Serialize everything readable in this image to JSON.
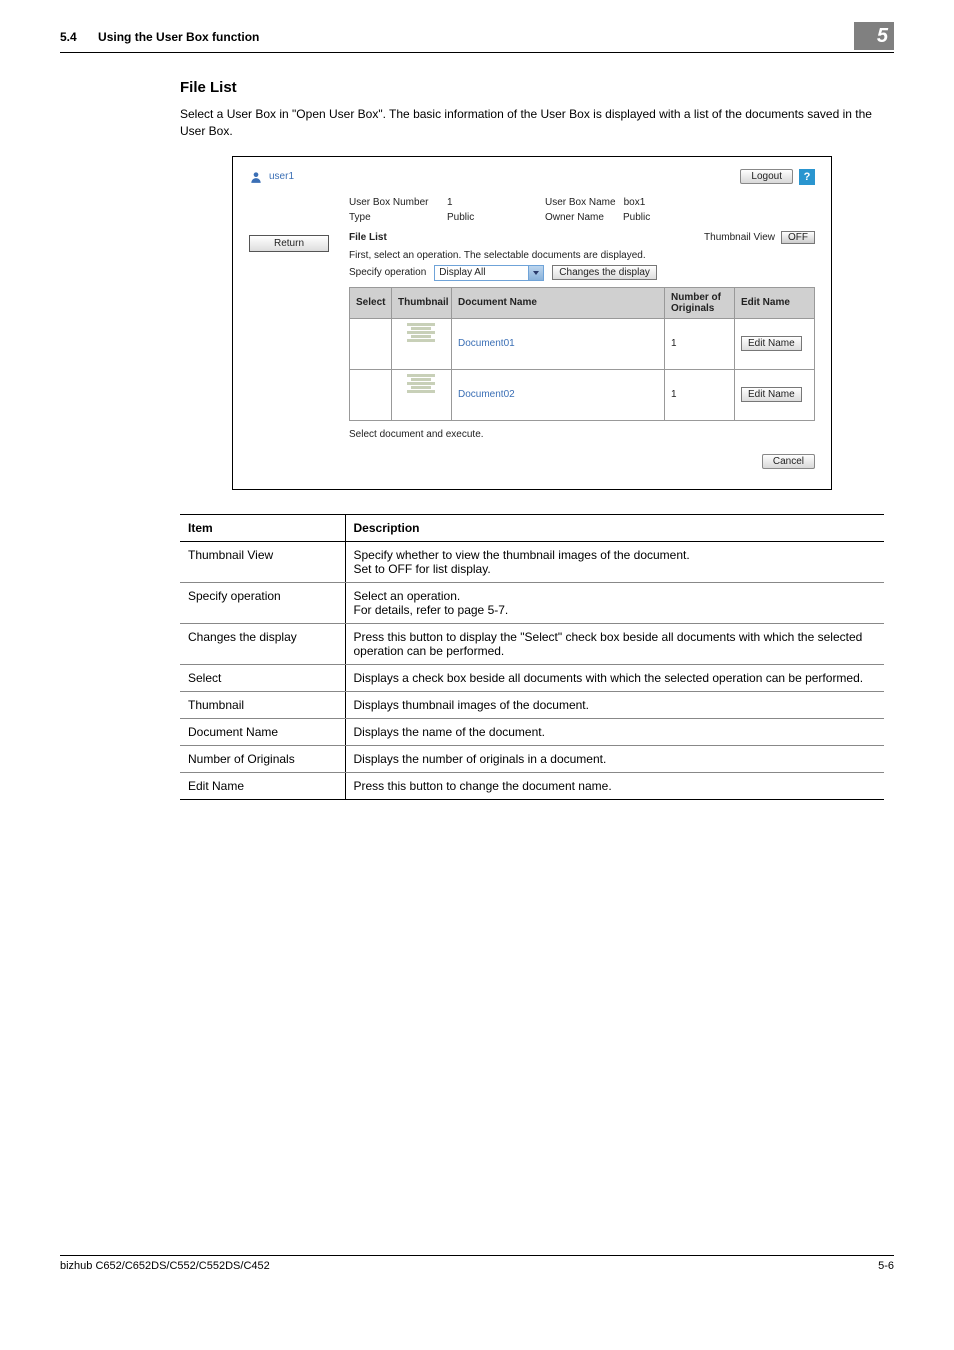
{
  "header": {
    "section_num": "5.4",
    "section_title": "Using the User Box function",
    "chapter_badge": "5"
  },
  "body": {
    "h2": "File List",
    "intro": "Select a User Box in \"Open User Box\". The basic information of the User Box is displayed with a list of the documents saved in the User Box."
  },
  "shot": {
    "username": "user1",
    "logout": "Logout",
    "help": "?",
    "return": "Return",
    "kv": {
      "boxnum_label": "User Box Number",
      "boxnum_value": "1",
      "boxname_label": "User Box Name",
      "boxname_value": "box1",
      "type_label": "Type",
      "type_value": "Public",
      "owner_label": "Owner Name",
      "owner_value": "Public"
    },
    "file_list_label": "File List",
    "thumb_view_label": "Thumbnail View",
    "thumb_view_btn": "OFF",
    "first_select": "First, select an operation. The selectable documents are displayed.",
    "specify_op_label": "Specify operation",
    "specify_op_value": "Display All",
    "changes_btn": "Changes the display",
    "cols": {
      "select": "Select",
      "thumb": "Thumbnail",
      "docname": "Document Name",
      "numorig": "Number of Originals",
      "editname": "Edit Name"
    },
    "rows": [
      {
        "name": "Document01",
        "num": "1",
        "edit": "Edit Name"
      },
      {
        "name": "Document02",
        "num": "1",
        "edit": "Edit Name"
      }
    ],
    "below": "Select document and execute.",
    "cancel": "Cancel"
  },
  "table": {
    "head_item": "Item",
    "head_desc": "Description",
    "rows": [
      {
        "item": "Thumbnail View",
        "desc": "Specify whether to view the thumbnail images of the document.\nSet to OFF for list display."
      },
      {
        "item": "Specify operation",
        "desc": "Select an operation.\nFor details, refer to page 5-7."
      },
      {
        "item": "Changes the display",
        "desc": "Press this button to display the \"Select\" check box beside all documents with which the selected operation can be performed."
      },
      {
        "item": "Select",
        "desc": "Displays a check box beside all documents with which the selected operation can be performed."
      },
      {
        "item": "Thumbnail",
        "desc": "Displays thumbnail images of the document."
      },
      {
        "item": "Document Name",
        "desc": "Displays the name of the document."
      },
      {
        "item": "Number of Originals",
        "desc": "Displays the number of originals in a document."
      },
      {
        "item": "Edit Name",
        "desc": "Press this button to change the document name."
      }
    ]
  },
  "footer": {
    "left": "bizhub C652/C652DS/C552/C552DS/C452",
    "right": "5-6"
  }
}
